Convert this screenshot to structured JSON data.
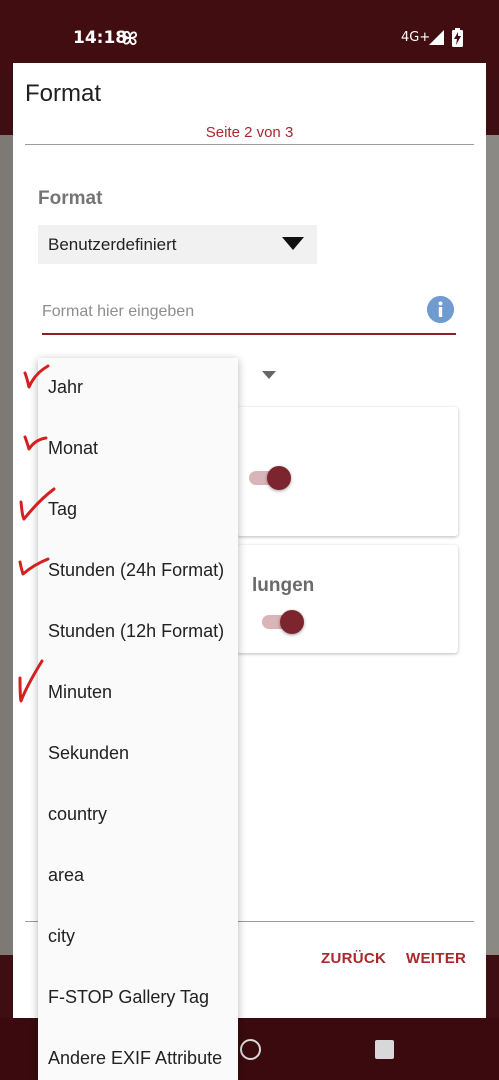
{
  "status_bar": {
    "time": "14:18",
    "network": "4G+",
    "icons": [
      "pinwheel-icon",
      "signal-icon",
      "battery-charging-icon"
    ]
  },
  "dialog": {
    "title": "Format",
    "page_indicator": "Seite 2 von 3",
    "section_title": "Format",
    "format_select": {
      "selected": "Benutzerdefiniert"
    },
    "format_input": {
      "value": "",
      "placeholder": "Format hier eingeben"
    },
    "card2_text": "lungen",
    "buttons": {
      "back": "ZURÜCK",
      "next": "WEITER"
    }
  },
  "dropdown_menu": {
    "items": [
      {
        "label": "Jahr",
        "checked": true
      },
      {
        "label": "Monat",
        "checked": true
      },
      {
        "label": "Tag",
        "checked": true
      },
      {
        "label": "Stunden (24h Format)",
        "checked": true
      },
      {
        "label": "Stunden (12h Format)",
        "checked": false
      },
      {
        "label": "Minuten",
        "checked": true
      },
      {
        "label": "Sekunden",
        "checked": false
      },
      {
        "label": "country",
        "checked": false
      },
      {
        "label": "area",
        "checked": false
      },
      {
        "label": "city",
        "checked": false
      },
      {
        "label": "F-STOP Gallery Tag",
        "checked": false
      },
      {
        "label": "Andere EXIF Attribute",
        "checked": false
      }
    ]
  },
  "colors": {
    "accent": "#a8282c",
    "toggle_thumb": "#7c252e",
    "status_bar": "#420d10",
    "handwritten_check": "#d42020",
    "info_icon": "#6f9bd1"
  }
}
